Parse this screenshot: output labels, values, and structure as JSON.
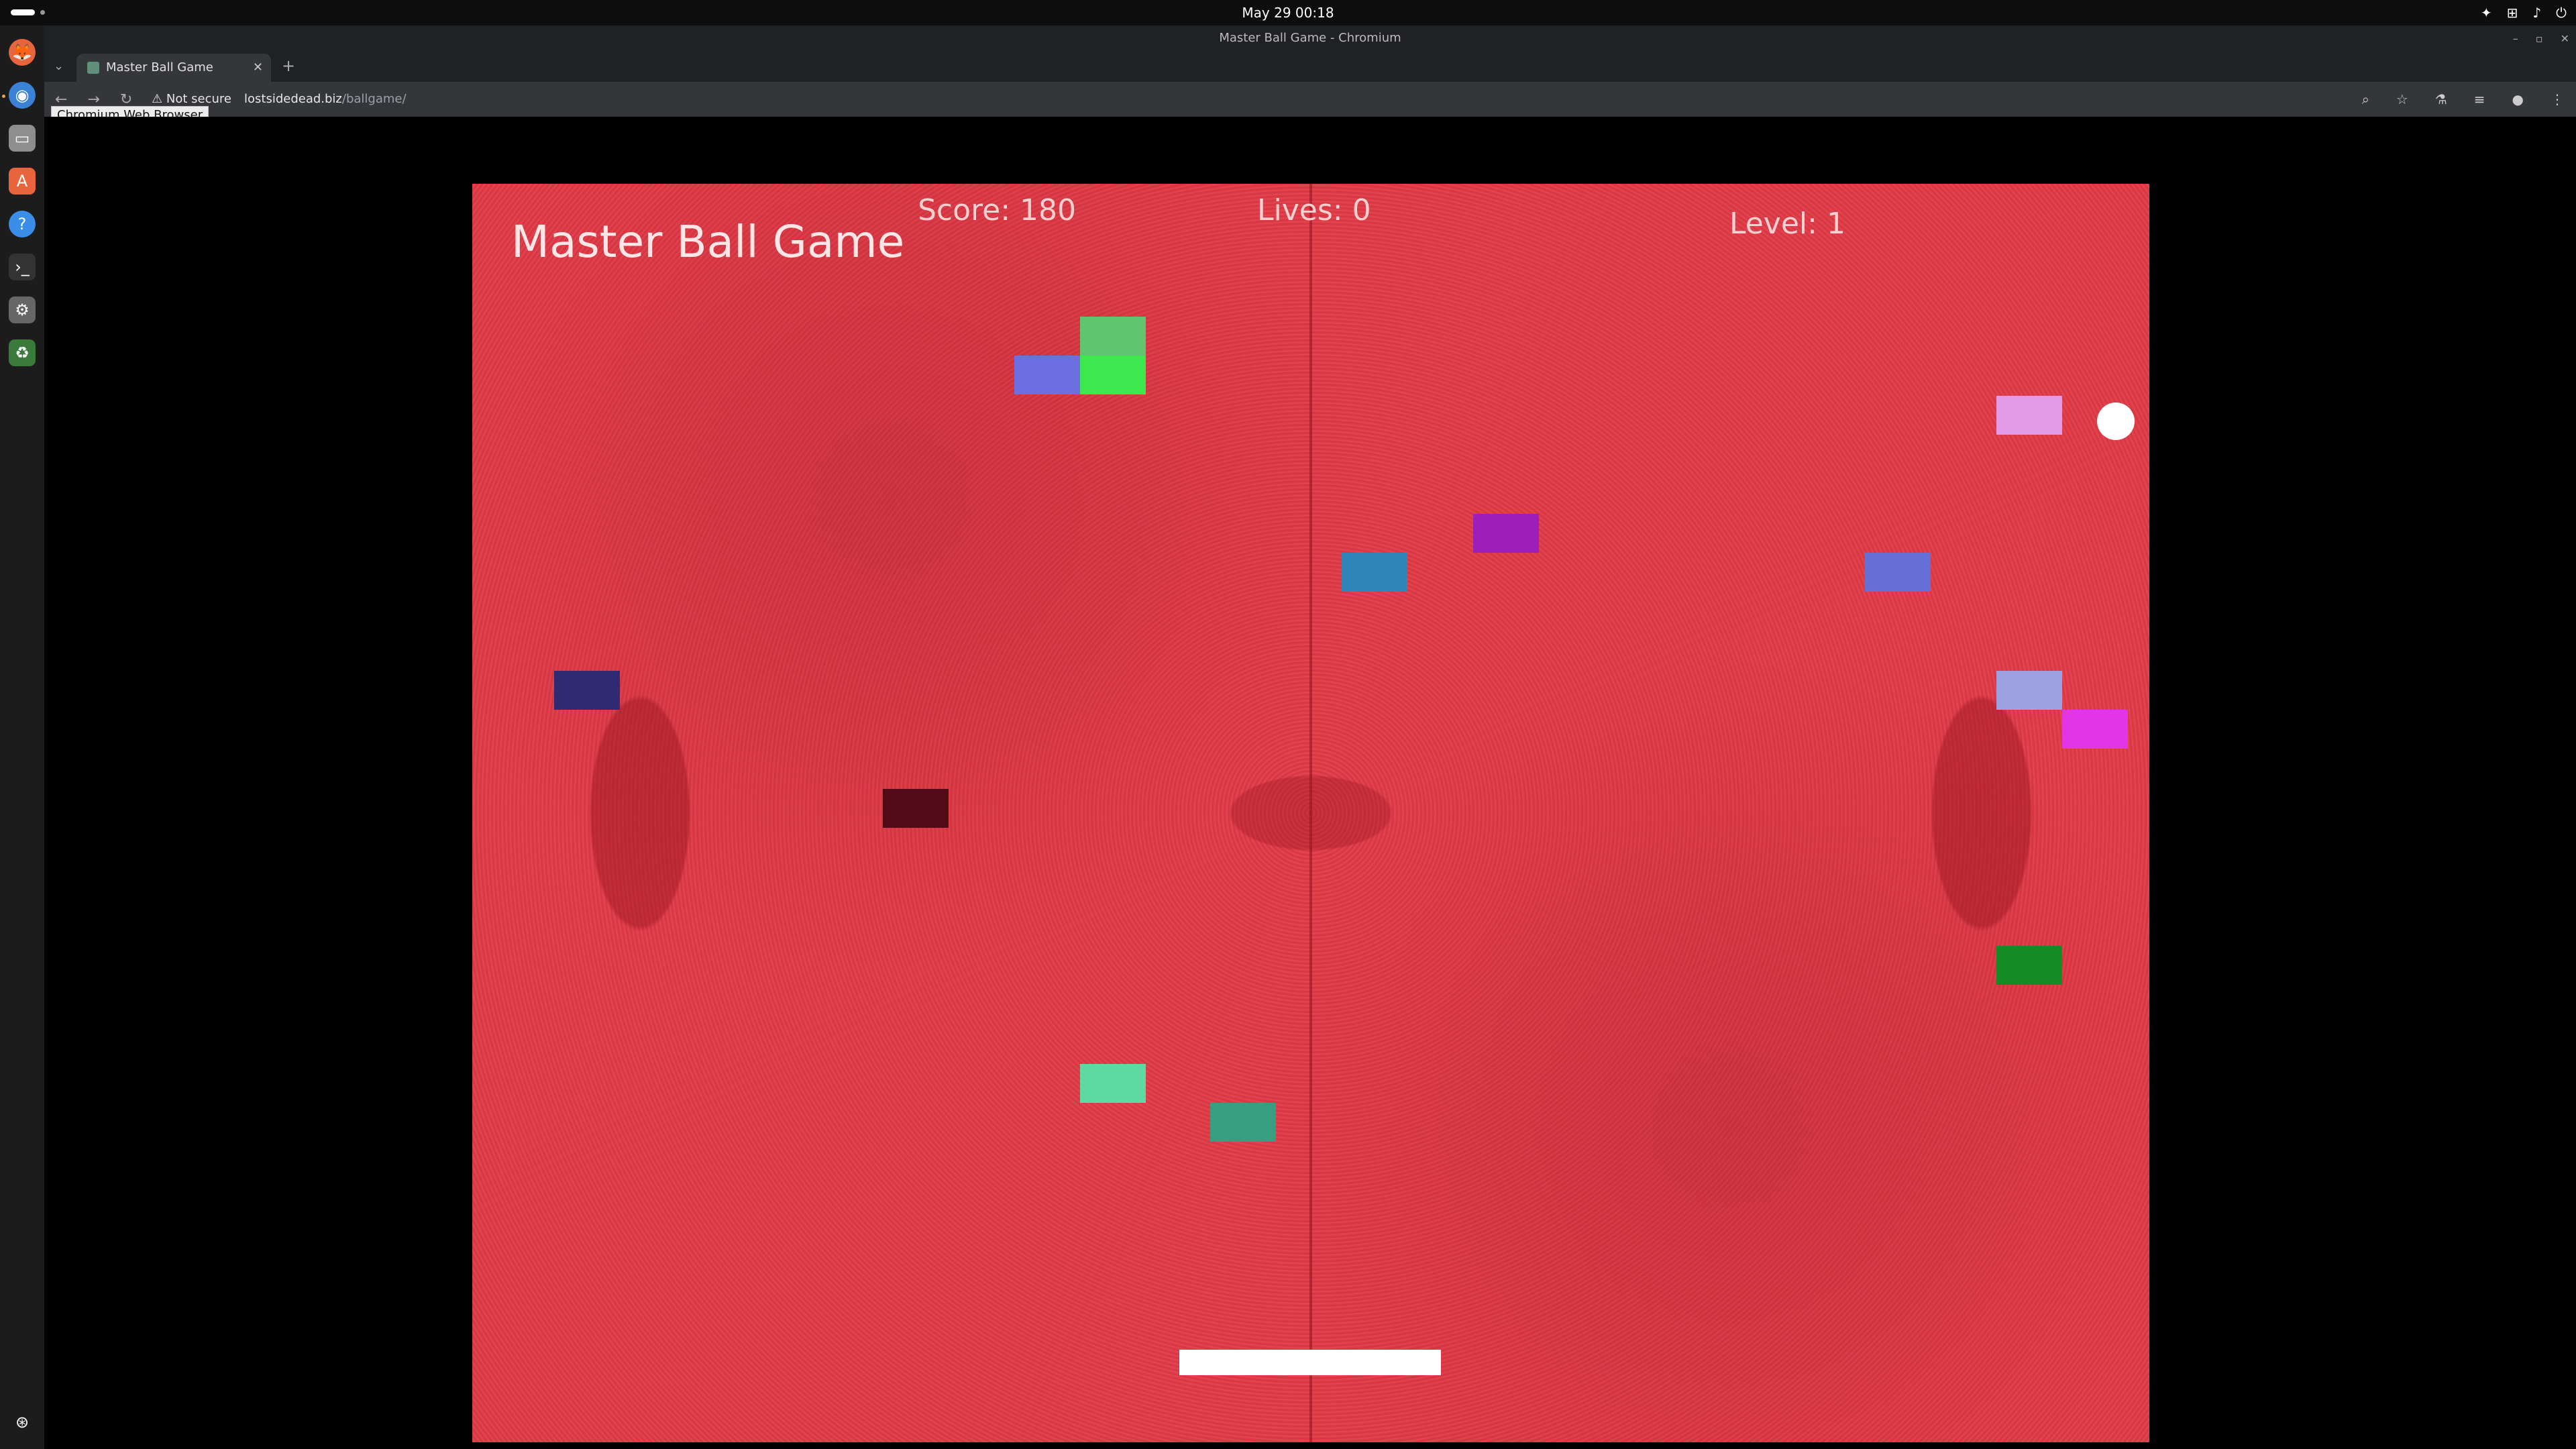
{
  "system": {
    "clock": "May 29  00:18",
    "tray_icons": [
      "accessibility-icon",
      "network-icon",
      "volume-icon",
      "power-icon"
    ]
  },
  "dock": {
    "items": [
      "firefox-icon",
      "chromium-icon",
      "files-icon",
      "software-icon",
      "help-icon",
      "terminal-icon",
      "settings-icon",
      "trash-icon"
    ],
    "bottom": "show-apps-icon"
  },
  "window": {
    "title": "Master Ball Game - Chromium"
  },
  "tabs": [
    {
      "title": "Master Ball Game",
      "active": true
    }
  ],
  "tooltip": "Chromium Web Browser",
  "address_bar": {
    "security": "Not secure",
    "host": "lostsidedead.biz",
    "path": "/ballgame/"
  },
  "game": {
    "title": "Master Ball Game",
    "score": "Score: 180",
    "lives": "Lives: 0",
    "level": "Level: 1",
    "colors": {
      "background": "#e04450",
      "paddle": "#ffffff",
      "ball": "#ffffff"
    },
    "bricks": [
      {
        "color": "#61c46e"
      },
      {
        "color": "#6b6fe0"
      },
      {
        "color": "#3de84e"
      },
      {
        "color": "#e39ae8"
      },
      {
        "color": "#9b1fb8"
      },
      {
        "color": "#2f86b8"
      },
      {
        "color": "#6670d4"
      },
      {
        "color": "#302a72"
      },
      {
        "color": "#9da0e2"
      },
      {
        "color": "#e236e6"
      },
      {
        "color": "#520b16"
      },
      {
        "color": "#168a24"
      },
      {
        "color": "#5ed9a2"
      },
      {
        "color": "#379e80"
      }
    ]
  }
}
